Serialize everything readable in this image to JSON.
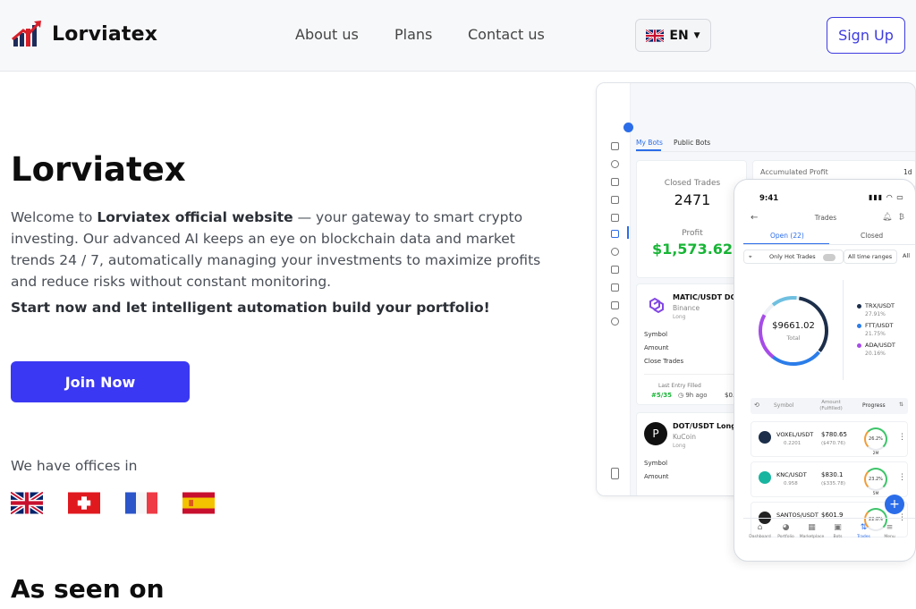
{
  "header": {
    "brand": "Lorviatex",
    "nav": [
      "About us",
      "Plans",
      "Contact us"
    ],
    "language": "EN",
    "signup_label": "Sign Up"
  },
  "hero": {
    "title": "Lorviatex",
    "intro_prefix": "Welcome to ",
    "intro_bold": "Lorviatex official website",
    "intro_rest": " — your gateway to smart crypto investing. Our advanced AI keeps an eye on blockchain data and market trends 24 / 7, automatically managing your investments to maximize profits and reduce risks without constant monitoring.",
    "cta_text": "Start now and let intelligent automation build your portfolio!",
    "join_label": "Join Now",
    "offices_label": "We have offices in",
    "offices": [
      "united-kingdom-flag",
      "switzerland-flag",
      "france-flag",
      "spain-flag"
    ],
    "seen_title": "As seen on"
  },
  "dashboard": {
    "tabs": [
      "My Bots",
      "Public Bots"
    ],
    "closed_trades_label": "Closed Trades",
    "closed_trades_value": "2471",
    "profit_label": "Profit",
    "profit_value": "$1,573.62",
    "accumulated_label": "Accumulated Profit",
    "accumulated_period": "1d",
    "bot1": {
      "pair": "MATIC/USDT DC",
      "exchange": "Binance",
      "side": "Long",
      "rows": [
        "Symbol",
        "Amount",
        "Close Trades"
      ],
      "last_entry": "Last Entry Filled",
      "count": "#5/35",
      "time": "9h ago",
      "trunc": "$0."
    },
    "bot2": {
      "pair": "DOT/USDT Long",
      "exchange": "KuCoin",
      "side": "Long",
      "rows": [
        "Symbol",
        "Amount"
      ]
    }
  },
  "phone": {
    "time": "9:41",
    "title": "Trades",
    "tabs": [
      "Open (22)",
      "Closed"
    ],
    "filters": [
      "Only Hot Trades",
      "All time ranges",
      "All"
    ],
    "total_value": "$9661.02",
    "total_label": "Total",
    "legend": [
      {
        "name": "TRX/USDT",
        "pct": "27.91%",
        "color": "#1c2e4a"
      },
      {
        "name": "FTT/USDT",
        "pct": "21.75%",
        "color": "#2b7de9"
      },
      {
        "name": "ADA/USDT",
        "pct": "20.16%",
        "color": "#a64ce8"
      }
    ],
    "table_headers": [
      "Symbol",
      "Amount (Fulfilled)",
      "Progress"
    ],
    "trades": [
      {
        "symbol": "VOXEL/USDT",
        "sub": "0.2201",
        "amount": "$780.65",
        "fulfilled": "($470.76)",
        "progress": "26.2%",
        "extra": "2M"
      },
      {
        "symbol": "KNC/USDT",
        "sub": "0.958",
        "amount": "$830.1",
        "fulfilled": "($335.78)",
        "progress": "23.2%",
        "extra": "5M"
      },
      {
        "symbol": "SANTOS/USDT",
        "sub": "",
        "amount": "$601.9",
        "fulfilled": "",
        "progress": "22.8%",
        "extra": ""
      }
    ],
    "bottom_nav": [
      "Dashboard",
      "Portfolio",
      "Marketplace",
      "Bots",
      "Trades",
      "Menu"
    ]
  }
}
